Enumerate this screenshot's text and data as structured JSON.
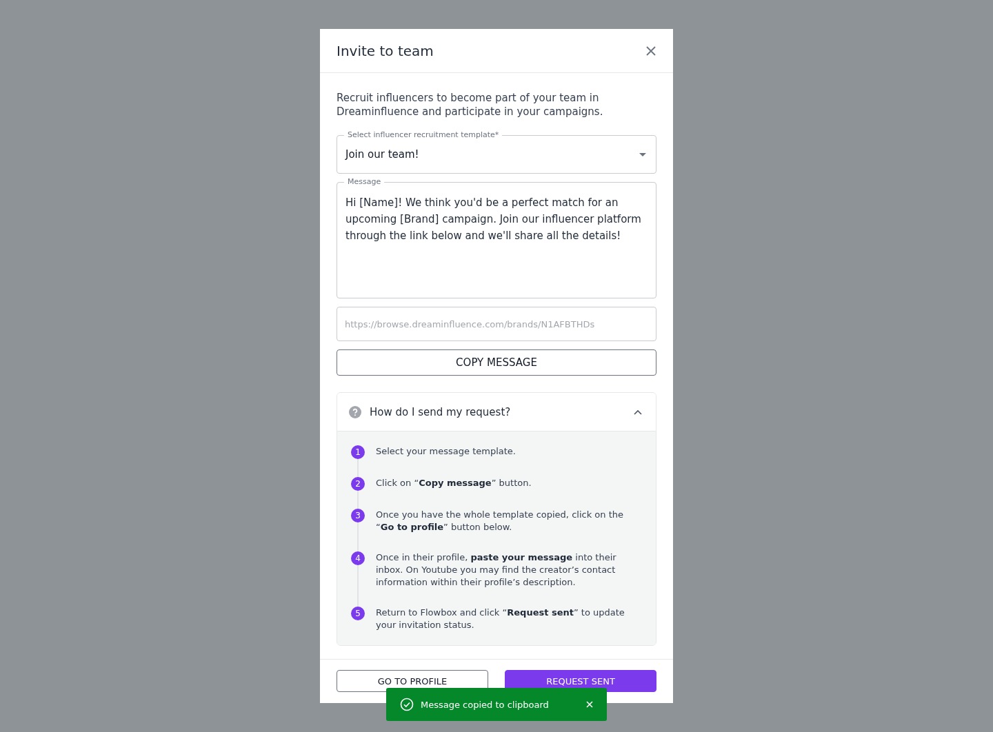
{
  "dialog": {
    "title": "Invite to team",
    "description": "Recruit influencers to become part of your team in Dreaminfluence and participate in your campaigns.",
    "template_select": {
      "label": "Select influencer recruitment template*",
      "value": "Join our team!"
    },
    "message_field": {
      "label": "Message",
      "value": "Hi [Name]! We think you'd be a perfect match for an upcoming [Brand] campaign. Join our influencer platform through the link below and we'll share all the details!"
    },
    "link_field": {
      "value": "https://browse.dreaminfluence.com/brands/N1AFBTHDs",
      "disabled": true
    },
    "copy_button": "COPY MESSAGE",
    "help": {
      "title": "How do I send my request?",
      "expanded": true,
      "steps": [
        {
          "number": "1",
          "text": "Select your message template."
        },
        {
          "number": "2",
          "text": "Click on “**Copy message**” button."
        },
        {
          "number": "3",
          "text": "Once you have the whole template copied, click on the “**Go to profile**” button below."
        },
        {
          "number": "4",
          "text": "Once in their profile, **paste your message** into their inbox. On Youtube you may find the creator’s contact information within their profile’s description."
        },
        {
          "number": "5",
          "text": "Return to Flowbox and click “**Request sent**” to update your invitation status."
        }
      ]
    },
    "buttons": [
      {
        "label": "GO TO PROFILE",
        "kind": "outlined"
      },
      {
        "label": "REQUEST SENT",
        "kind": "contained"
      }
    ]
  },
  "toast": {
    "message": "Message copied to clipboard"
  }
}
